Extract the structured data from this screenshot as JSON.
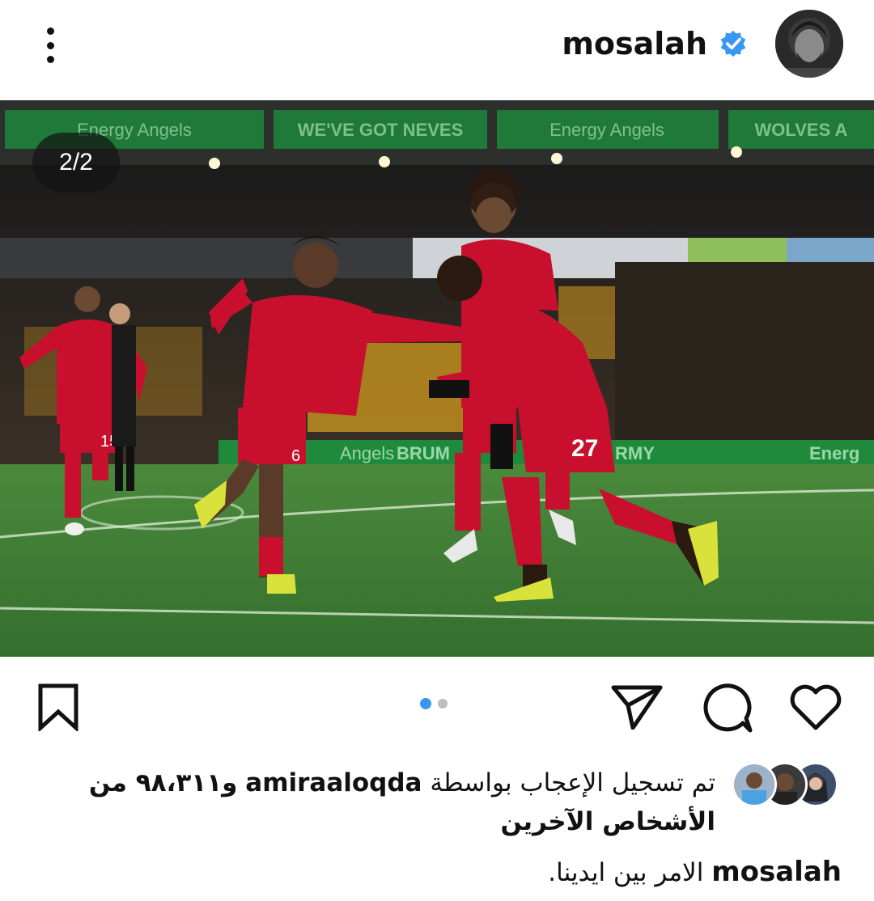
{
  "post": {
    "username": "mosalah",
    "verified": true,
    "photo_counter": "2/2",
    "carousel": {
      "count": 2,
      "active_index": 1
    },
    "stadium_boards": [
      "Energy Angels",
      "WE'VE GOT NEVES",
      "Energy Angels",
      "WOLVES A"
    ],
    "pitch_boards": [
      "Angels",
      "BRUM",
      "RMY",
      "Energ"
    ],
    "jersey_numbers": [
      "15",
      "6",
      "27"
    ]
  },
  "likes": {
    "prefix": "تم تسجيل الإعجاب بواسطة",
    "liker": "amiraaloqda",
    "suffix": "و٩٨،٣١١ من الأشخاص الآخرين"
  },
  "caption": {
    "username": "mosalah",
    "text": "الامر بين ايدينا."
  },
  "icons": {
    "more": "more-vertical-icon",
    "verified": "verified-badge-icon",
    "bookmark": "bookmark-icon",
    "share": "share-icon",
    "comment": "comment-icon",
    "like": "heart-icon"
  },
  "colors": {
    "accent": "#3897f0",
    "verified": "#3897f0",
    "kit_red": "#c8102e",
    "pitch": "#3f7d35"
  }
}
